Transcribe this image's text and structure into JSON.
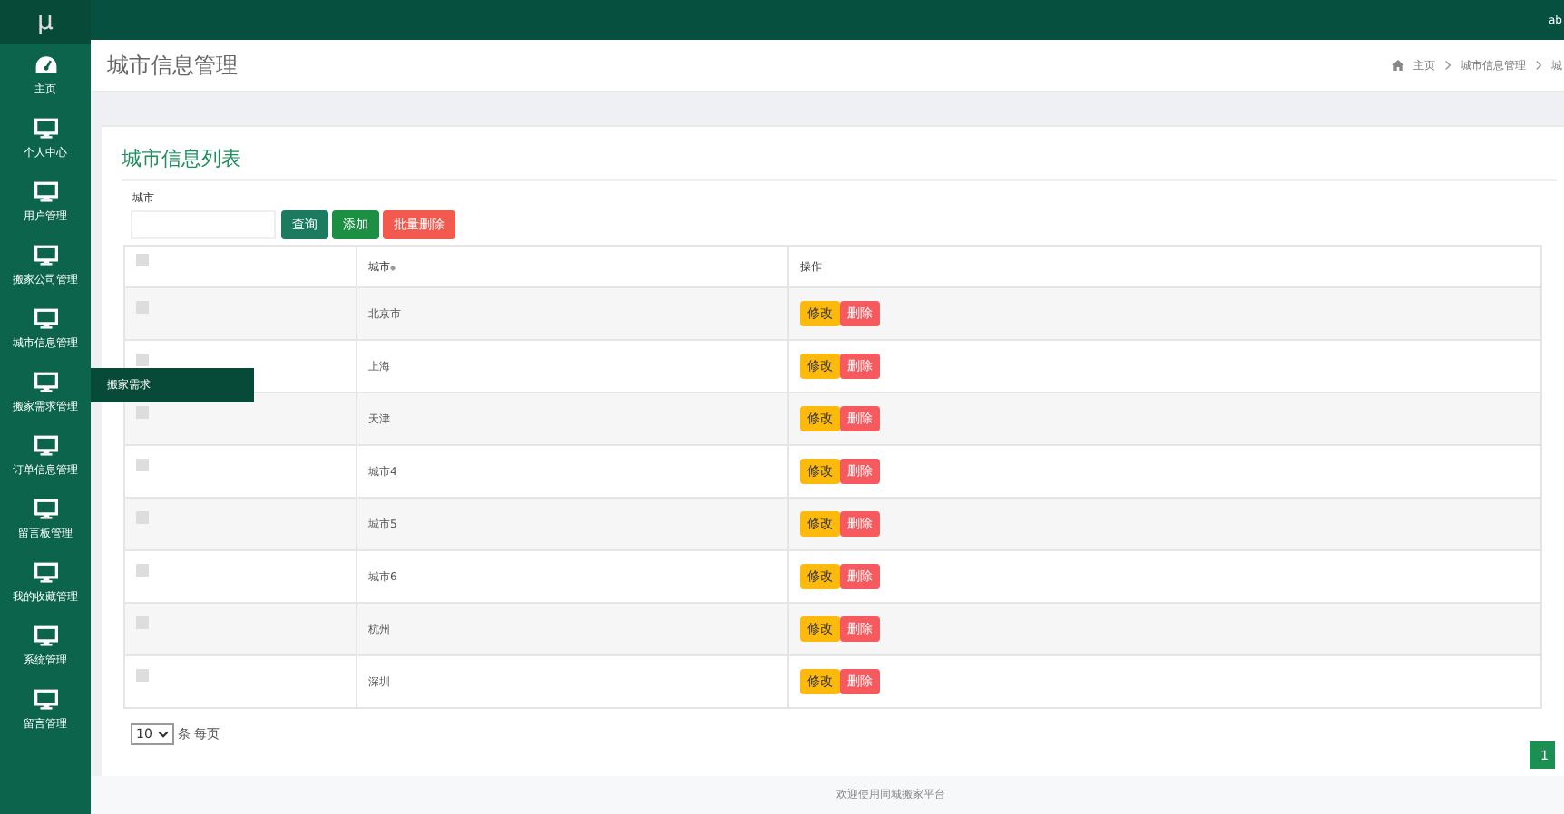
{
  "logo": "μ",
  "top_bar": {
    "user": "ab"
  },
  "sidebar": {
    "items": [
      {
        "label": "主页"
      },
      {
        "label": "个人中心"
      },
      {
        "label": "用户管理"
      },
      {
        "label": "搬家公司管理"
      },
      {
        "label": "城市信息管理"
      },
      {
        "label": "搬家需求管理",
        "submenu": [
          "搬家需求"
        ]
      },
      {
        "label": "订单信息管理"
      },
      {
        "label": "留言板管理"
      },
      {
        "label": "我的收藏管理"
      },
      {
        "label": "系统管理"
      },
      {
        "label": "留言管理"
      }
    ]
  },
  "page_title": "城市信息管理",
  "breadcrumb": [
    "主页",
    "城市信息管理",
    "城"
  ],
  "card": {
    "title": "城市信息列表",
    "search": {
      "label": "城市"
    },
    "buttons": [
      {
        "label": "查询",
        "kind": "query"
      },
      {
        "label": "添加",
        "kind": "add"
      },
      {
        "label": "批量删除",
        "kind": "delete"
      }
    ],
    "table": {
      "columns": [
        "城市",
        "操作"
      ],
      "sort_mark": "◆",
      "header_checked": false,
      "rows": [
        {
          "city": "北京市",
          "checked": false,
          "actions": [
            "修改",
            "删除"
          ]
        },
        {
          "city": "上海",
          "checked": false,
          "actions": [
            "修改",
            "删除"
          ]
        },
        {
          "city": "天津",
          "checked": false,
          "actions": [
            "修改",
            "删除"
          ]
        },
        {
          "city": "城市4",
          "checked": false,
          "actions": [
            "修改",
            "删除"
          ]
        },
        {
          "city": "城市5",
          "checked": false,
          "actions": [
            "修改",
            "删除"
          ]
        },
        {
          "city": "城市6",
          "checked": false,
          "actions": [
            "修改",
            "删除"
          ]
        },
        {
          "city": "杭州",
          "checked": false,
          "actions": [
            "修改",
            "删除"
          ]
        },
        {
          "city": "深圳",
          "checked": false,
          "actions": [
            "修改",
            "删除"
          ]
        }
      ]
    },
    "page_size": "10",
    "page_size_suffix": "条 每页"
  },
  "pagination": [
    {
      "label": "1",
      "selected": true
    }
  ],
  "footer": "欢迎使用同城搬家平台"
}
